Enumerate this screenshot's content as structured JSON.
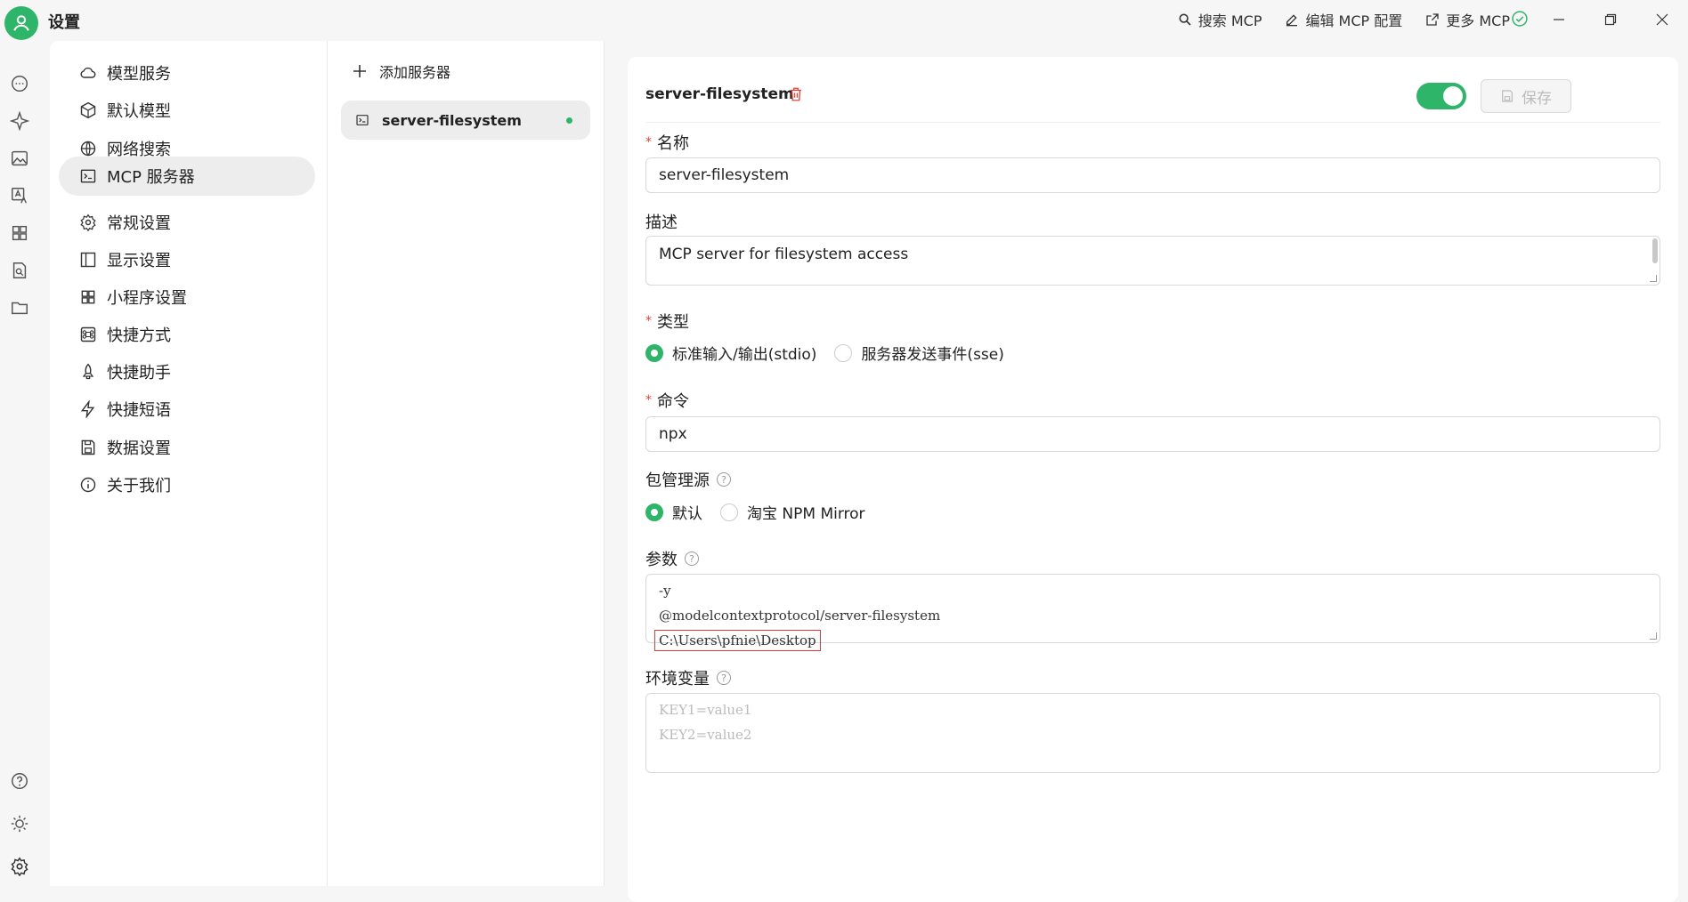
{
  "titlebar": {
    "title": "设置",
    "actions": [
      {
        "label": "搜索 MCP",
        "icon": "search-icon"
      },
      {
        "label": "编辑 MCP 配置",
        "icon": "edit-icon"
      },
      {
        "label": "更多 MCP",
        "icon": "external-link-icon"
      }
    ]
  },
  "colors": {
    "accent": "#2fb56a",
    "danger": "#e0453a"
  },
  "nav": {
    "items": [
      {
        "label": "模型服务",
        "icon": "cloud-icon"
      },
      {
        "label": "默认模型",
        "icon": "cube-icon"
      },
      {
        "label": "网络搜索",
        "icon": "globe-icon"
      },
      {
        "label": "MCP 服务器",
        "icon": "terminal-icon",
        "active": true
      },
      {
        "label": "常规设置",
        "icon": "gear-icon"
      },
      {
        "label": "显示设置",
        "icon": "layout-icon"
      },
      {
        "label": "小程序设置",
        "icon": "apps-icon"
      },
      {
        "label": "快捷方式",
        "icon": "command-icon"
      },
      {
        "label": "快捷助手",
        "icon": "rocket-icon"
      },
      {
        "label": "快捷短语",
        "icon": "zap-icon"
      },
      {
        "label": "数据设置",
        "icon": "save-icon"
      },
      {
        "label": "关于我们",
        "icon": "info-icon"
      }
    ]
  },
  "servers": {
    "add_label": "添加服务器",
    "items": [
      {
        "name": "server-filesystem",
        "status": "active"
      }
    ]
  },
  "detail": {
    "title": "server-filesystem",
    "enabled": true,
    "save_label": "保存",
    "name_label": "名称",
    "name_value": "server-filesystem",
    "desc_label": "描述",
    "desc_value": "MCP server for filesystem access",
    "type_label": "类型",
    "type_options": [
      "标准输入/输出(stdio)",
      "服务器发送事件(sse)"
    ],
    "type_selected": 0,
    "command_label": "命令",
    "command_value": "npx",
    "pkg_label": "包管理源",
    "pkg_options": [
      "默认",
      "淘宝 NPM Mirror"
    ],
    "pkg_selected": 0,
    "args_label": "参数",
    "args_lines": [
      "-y",
      "@modelcontextprotocol/server-filesystem",
      "C:\\Users\\pfnie\\Desktop"
    ],
    "env_label": "环境变量",
    "env_placeholder_lines": [
      "KEY1=value1",
      "KEY2=value2"
    ]
  }
}
